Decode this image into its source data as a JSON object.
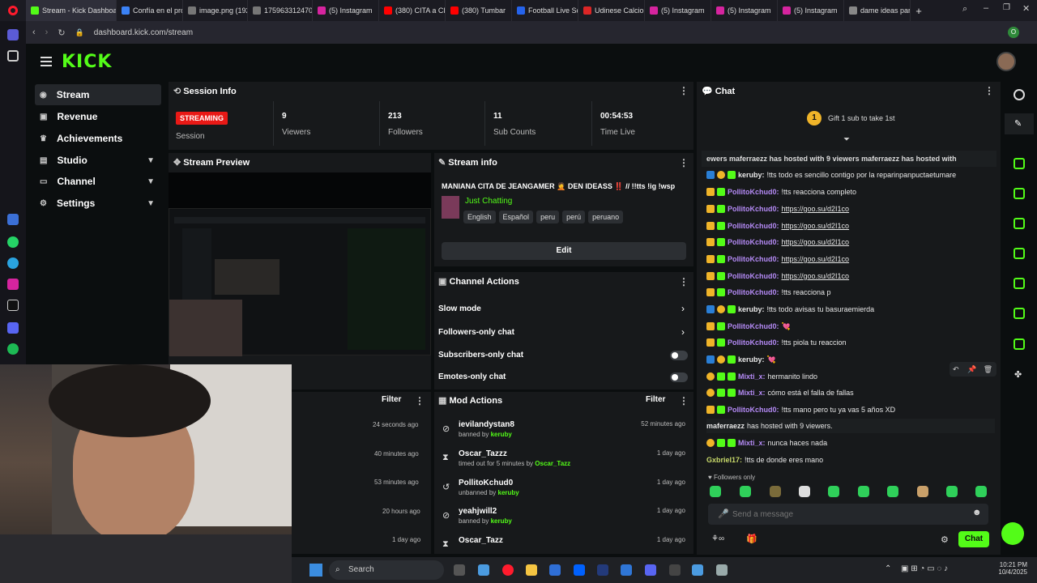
{
  "browser": {
    "tabs": [
      "Stream - Kick Dashboard",
      "Confía en el proc",
      "image.png (1920",
      "175963312470-5",
      "(5) Instagram",
      "(380) CITA a CIEG",
      "(380) Tumbar",
      "Football Live Sco",
      "Udinese Calcio",
      "(5) Instagram",
      "(5) Instagram",
      "(5) Instagram",
      "dame ideas para"
    ],
    "url": "dashboard.kick.com/stream",
    "profile_initial": "O"
  },
  "brand": {
    "logo": "KICK",
    "accent": "#53fc18"
  },
  "nav": [
    {
      "label": "Stream",
      "icon": "stream-icon",
      "active": true
    },
    {
      "label": "Revenue",
      "icon": "revenue-icon"
    },
    {
      "label": "Achievements",
      "icon": "trophy-icon"
    },
    {
      "label": "Studio",
      "icon": "studio-icon",
      "expand": true
    },
    {
      "label": "Channel",
      "icon": "channel-icon",
      "expand": true
    },
    {
      "label": "Settings",
      "icon": "gear-icon",
      "expand": true
    }
  ],
  "session": {
    "title": "Session Info",
    "status": "STREAMING",
    "status_label": "Session",
    "stats": [
      {
        "value": "9",
        "label": "Viewers"
      },
      {
        "value": "213",
        "label": "Followers"
      },
      {
        "value": "11",
        "label": "Sub Counts"
      },
      {
        "value": "00:54:53",
        "label": "Time Live"
      }
    ]
  },
  "preview": {
    "title": "Stream Preview"
  },
  "stream_info": {
    "title": "Stream info",
    "stream_title": "MANIANA CITA DE JEANGAMER 🤦 DEN IDEASS ‼️ // !!tts !ig !wsp",
    "category": "Just Chatting",
    "tags": [
      "English",
      "Español",
      "peru",
      "perú",
      "peruano"
    ],
    "edit_label": "Edit"
  },
  "channel_actions": {
    "title": "Channel Actions",
    "items": [
      "Slow mode",
      "Followers-only chat",
      "Subscribers-only chat",
      "Emotes-only chat"
    ]
  },
  "activity": {
    "filter_label": "Filter",
    "times": [
      "24 seconds ago",
      "40 minutes ago",
      "53 minutes ago",
      "20 hours ago",
      "1 day ago"
    ]
  },
  "mod_actions": {
    "title": "Mod Actions",
    "filter_label": "Filter",
    "rows": [
      {
        "name": "ievilandystan8",
        "detail": "banned by",
        "by": "keruby",
        "time": "52 minutes ago"
      },
      {
        "name": "Oscar_Tazzz",
        "detail": "timed out for 5 minutes by",
        "by": "Oscar_Tazz",
        "time": "1 day ago"
      },
      {
        "name": "PollitoKchud0",
        "detail": "unbanned by",
        "by": "keruby",
        "time": "1 day ago"
      },
      {
        "name": "yeahjwill2",
        "detail": "banned by",
        "by": "keruby",
        "time": "1 day ago"
      },
      {
        "name": "Oscar_Tazz",
        "detail": "",
        "by": "",
        "time": "1 day ago"
      }
    ]
  },
  "chat": {
    "title": "Chat",
    "gift_count": "1",
    "gift_text": "Gift 1 sub to take 1st",
    "ticker": "ewers  maferraezz has hosted with 9 viewers   maferraezz has hosted with",
    "messages": [
      {
        "user": "keruby:",
        "text": "!tts todo es sencillo contigo por la reparinpanpuctaetumare",
        "color": "#e8e8e8"
      },
      {
        "user": "PollitoKchud0:",
        "text": "!tts reacciona completo",
        "color": "#b48af5"
      },
      {
        "user": "PollitoKchud0:",
        "text": "https://goo.su/d2I1co",
        "color": "#b48af5",
        "link": true
      },
      {
        "user": "PollitoKchud0:",
        "text": "https://goo.su/d2I1co",
        "color": "#b48af5",
        "link": true
      },
      {
        "user": "PollitoKchud0:",
        "text": "https://goo.su/d2I1co",
        "color": "#b48af5",
        "link": true
      },
      {
        "user": "PollitoKchud0:",
        "text": "https://goo.su/d2I1co",
        "color": "#b48af5",
        "link": true
      },
      {
        "user": "PollitoKchud0:",
        "text": "https://goo.su/d2I1co",
        "color": "#b48af5",
        "link": true
      },
      {
        "user": "PollitoKchud0:",
        "text": "!tts reacciona p",
        "color": "#b48af5"
      },
      {
        "user": "keruby:",
        "text": "!tts todo avisas tu basuraemierda",
        "color": "#e8e8e8"
      },
      {
        "user": "PollitoKchud0:",
        "text": "💘",
        "color": "#b48af5"
      },
      {
        "user": "PollitoKchud0:",
        "text": "!tts piola tu reaccion",
        "color": "#b48af5"
      },
      {
        "user": "keruby:",
        "text": "💘",
        "color": "#e8e8e8"
      },
      {
        "user": "Mixti_x:",
        "text": "hermanito lindo",
        "color": "#b48af5"
      },
      {
        "user": "Mixti_x:",
        "text": "cómo está el falla de fallas",
        "color": "#b48af5"
      },
      {
        "user": "PollitoKchud0:",
        "text": "!tts mano pero tu ya vas 5 años XD",
        "color": "#b48af5"
      },
      {
        "user": "maferraezz",
        "text": "has hosted with 9 viewers.",
        "color": "#e8e8e8"
      },
      {
        "user": "Mixti_x:",
        "text": "nunca haces nada",
        "color": "#b48af5"
      },
      {
        "user": "Gxbriel17:",
        "text": "!tts de donde eres mano",
        "color": "#c8d96a"
      }
    ],
    "followers_only": "Followers only",
    "input_placeholder": "Send a message",
    "send_label": "Chat"
  },
  "taskbar": {
    "search_label": "Search",
    "time": "10:21 PM",
    "date": "10/4/2025"
  }
}
